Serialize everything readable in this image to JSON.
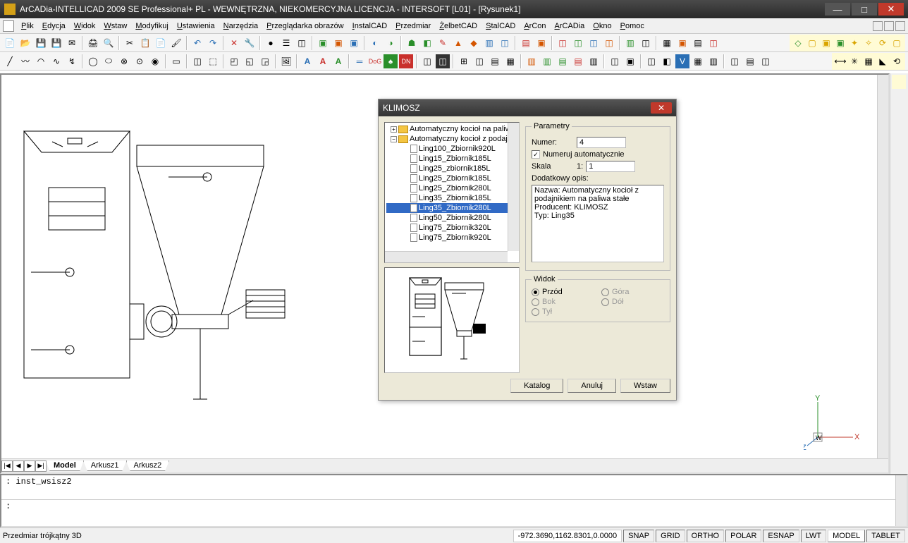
{
  "titlebar": {
    "text": "ArCADia-INTELLICAD 2009 SE Professional+ PL - WEWNĘTRZNA, NIEKOMERCYJNA LICENCJA - INTERSOFT [L01] - [Rysunek1]"
  },
  "menu": {
    "items": [
      "Plik",
      "Edycja",
      "Widok",
      "Wstaw",
      "Modyfikuj",
      "Ustawienia",
      "Narzędzia",
      "Przeglądarka obrazów",
      "InstalCAD",
      "Przedmiar",
      "ŻelbetCAD",
      "StalCAD",
      "ArCon",
      "ArCADia",
      "Okno",
      "Pomoc"
    ]
  },
  "sheets": {
    "tabs": [
      "Model",
      "Arkusz1",
      "Arkusz2"
    ],
    "active": 0
  },
  "command": {
    "line1": ": inst_wsisz2",
    "prompt": ":"
  },
  "status": {
    "hint": "Przedmiar trójkątny 3D",
    "coords": "-972.3690,1162.8301,0.0000",
    "toggles": [
      "SNAP",
      "GRID",
      "ORTHO",
      "POLAR",
      "ESNAP",
      "LWT",
      "MODEL",
      "TABLET"
    ],
    "activeToggle": "MODEL"
  },
  "dialog": {
    "title": "KLIMOSZ",
    "tree": {
      "parent1": "Automatyczny kocioł na paliw",
      "parent2": "Automatyczny kocioł z podajn",
      "items": [
        "Ling100_Zbiornik920L",
        "Ling15_Zbiornik185L",
        "Ling25_zbiornik185L",
        "Ling25_Zbiornik185L",
        "Ling25_Zbiornik280L",
        "Ling35_Zbiornik185L",
        "Ling35_Zbiornik280L",
        "Ling50_Zbiornik280L",
        "Ling75_Zbiornik320L",
        "Ling75_Zbiornik920L"
      ],
      "selectedIndex": 6
    },
    "params": {
      "legend": "Parametry",
      "numerLabel": "Numer:",
      "numerValue": "4",
      "autoLabel": "Numeruj automatycznie",
      "autoChecked": true,
      "skalaLabel": "Skala",
      "skalaPrefix": "1:",
      "skalaValue": "1",
      "opisLabel": "Dodatkowy opis:",
      "opisValue": "Nazwa: Automatyczny kocioł z podajnikiem na paliwa stałe\nProducent: KLIMOSZ\nTyp: Ling35"
    },
    "view": {
      "legend": "Widok",
      "options": [
        {
          "label": "Przód",
          "checked": true,
          "enabled": true
        },
        {
          "label": "Góra",
          "checked": false,
          "enabled": false
        },
        {
          "label": "Bok",
          "checked": false,
          "enabled": false
        },
        {
          "label": "Dół",
          "checked": false,
          "enabled": false
        },
        {
          "label": "Tył",
          "checked": false,
          "enabled": false
        }
      ]
    },
    "buttons": {
      "katalog": "Katalog",
      "anuluj": "Anuluj",
      "wstaw": "Wstaw"
    }
  },
  "ucs": {
    "x": "X",
    "y": "Y",
    "z": "Z",
    "w": "W"
  }
}
